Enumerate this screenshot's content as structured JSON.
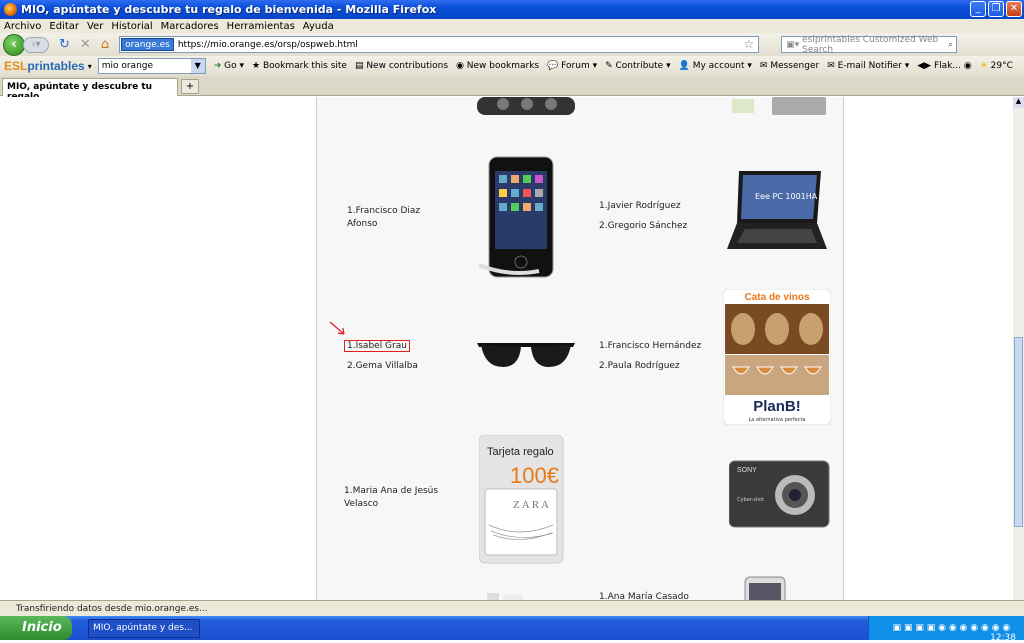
{
  "window": {
    "title": "MIO, apúntate y descubre tu regalo de bienvenida - Mozilla Firefox"
  },
  "menu": [
    "Archivo",
    "Editar",
    "Ver",
    "Historial",
    "Marcadores",
    "Herramientas",
    "Ayuda"
  ],
  "nav": {
    "site_id": "orange.es",
    "url": "https://mio.orange.es/orsp/ospweb.html",
    "search_placeholder": "eslprintables Customized Web Search"
  },
  "toolbar2": {
    "logo_a": "ESL",
    "logo_b": "printables",
    "select_value": "mio orange",
    "items": [
      "Go",
      "Bookmark this site",
      "New contributions",
      "New bookmarks",
      "Forum",
      "Contribute",
      "My account",
      "Messenger",
      "E-mail Notifier",
      "Flak...",
      "29°C"
    ]
  },
  "tab": {
    "label": "MIO, apúntate y descubre tu regalo ..."
  },
  "winners": {
    "row1_left": [
      "1.Francisco Diaz Afonso"
    ],
    "row1_right": [
      "1.Javier Rodríguez",
      "2.Gregorio Sánchez"
    ],
    "row2_left": [
      "1.Isabel Grau",
      "2.Gema Villalba"
    ],
    "row2_right": [
      "1.Francisco Hernández",
      "2.Paula Rodríguez"
    ],
    "row3_left": [
      "1.Maria Ana de Jesús Velasco"
    ],
    "row4_right": [
      "1.Ana María Casado"
    ]
  },
  "prizes": {
    "wine_title": "Cata de vinos",
    "wine_brand": "PlanB!",
    "wine_tag": "La alternativa perfecta",
    "netbook_label": "Eee PC 1001HA",
    "gift_title": "Tarjeta regalo",
    "gift_amount": "100€",
    "gift_brand": "ZARA",
    "camera_brand": "SONY",
    "camera_model": "Cyber-shot"
  },
  "status": {
    "text": "Transfiriendo datos desde mio.orange.es..."
  },
  "taskbar": {
    "start": "Inicio",
    "task": "MIO, apúntate y des...",
    "time": "12:38"
  }
}
